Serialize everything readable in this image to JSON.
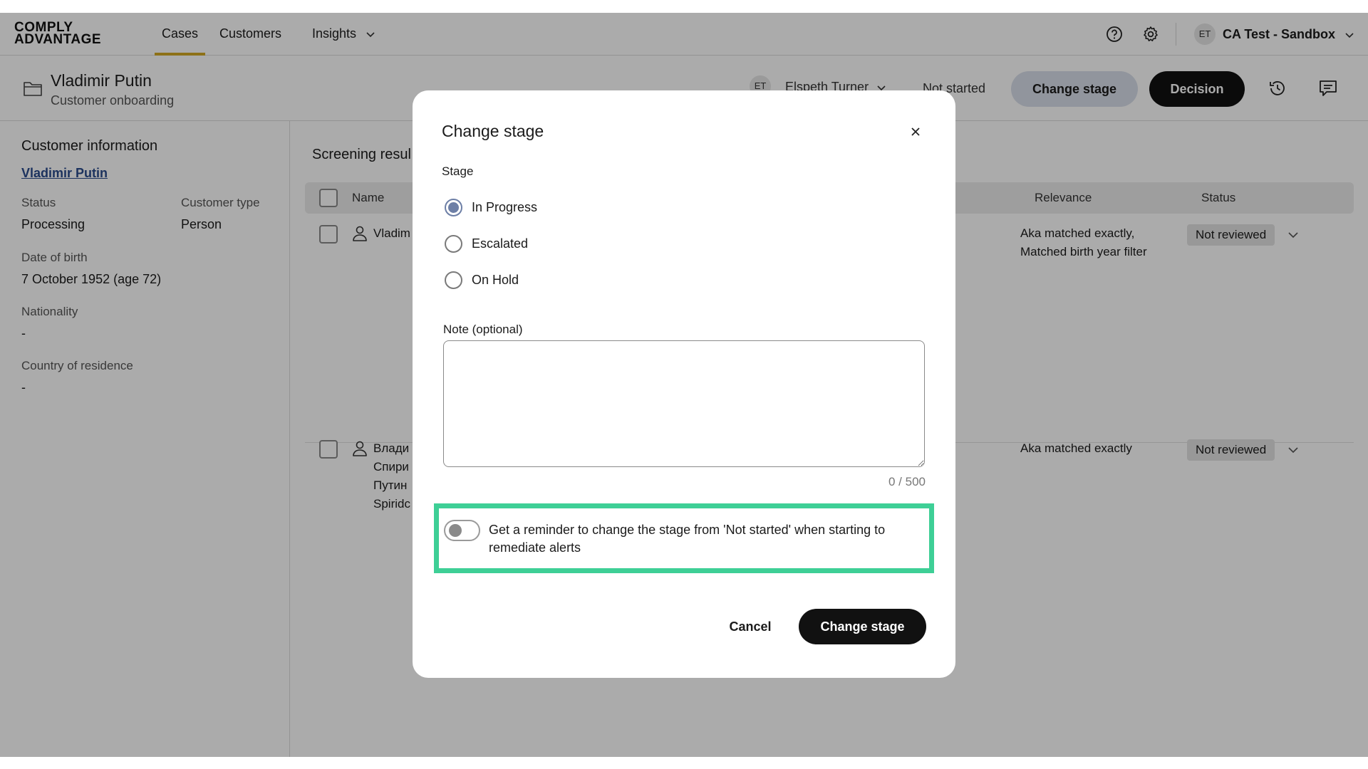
{
  "brand": {
    "line1": "COMPLY",
    "line2": "ADVANTAGE"
  },
  "nav": {
    "tabs": [
      {
        "label": "Cases"
      },
      {
        "label": "Customers"
      },
      {
        "label": "Insights"
      }
    ],
    "help_icon": "question-circle-icon",
    "settings_icon": "gear-icon",
    "user_initials": "ET",
    "org_name": "CA Test - Sandbox"
  },
  "case": {
    "title": "Vladimir Putin",
    "subtitle": "Customer onboarding",
    "assignee_initials": "ET",
    "assignee_name": "Elspeth Turner",
    "stage": "Not started",
    "change_stage_label": "Change stage",
    "decision_label": "Decision"
  },
  "customer_info": {
    "title": "Customer information",
    "name_link": "Vladimir Putin",
    "status_label": "Status",
    "status_value": "Processing",
    "type_label": "Customer type",
    "type_value": "Person",
    "dob_label": "Date of birth",
    "dob_value": "7 October 1952 (age 72)",
    "nationality_label": "Nationality",
    "nationality_value": "-",
    "residence_label": "Country of residence",
    "residence_value": "-"
  },
  "screening": {
    "title": "Screening resul",
    "columns": {
      "name": "Name",
      "relevance": "Relevance",
      "status": "Status"
    },
    "rows": [
      {
        "name_lines": [
          "Vladim"
        ],
        "relevance_lines": [
          "Aka matched exactly,",
          "Matched birth year filter"
        ],
        "status": "Not reviewed"
      },
      {
        "name_lines": [
          "Влади",
          "Спири",
          "Путин",
          "Spiridc"
        ],
        "relevance_lines": [
          "Aka matched exactly"
        ],
        "status": "Not reviewed"
      }
    ]
  },
  "modal": {
    "title": "Change stage",
    "stage_label": "Stage",
    "options": [
      {
        "label": "In Progress",
        "checked": true
      },
      {
        "label": "Escalated",
        "checked": false
      },
      {
        "label": "On Hold",
        "checked": false
      }
    ],
    "note_label": "Note (optional)",
    "note_value": "",
    "counter": "0 / 500",
    "reminder_text": "Get a reminder to change the stage from 'Not started' when starting to remediate alerts",
    "reminder_enabled": false,
    "cancel_label": "Cancel",
    "confirm_label": "Change stage",
    "highlight_color": "#3ecf96"
  }
}
